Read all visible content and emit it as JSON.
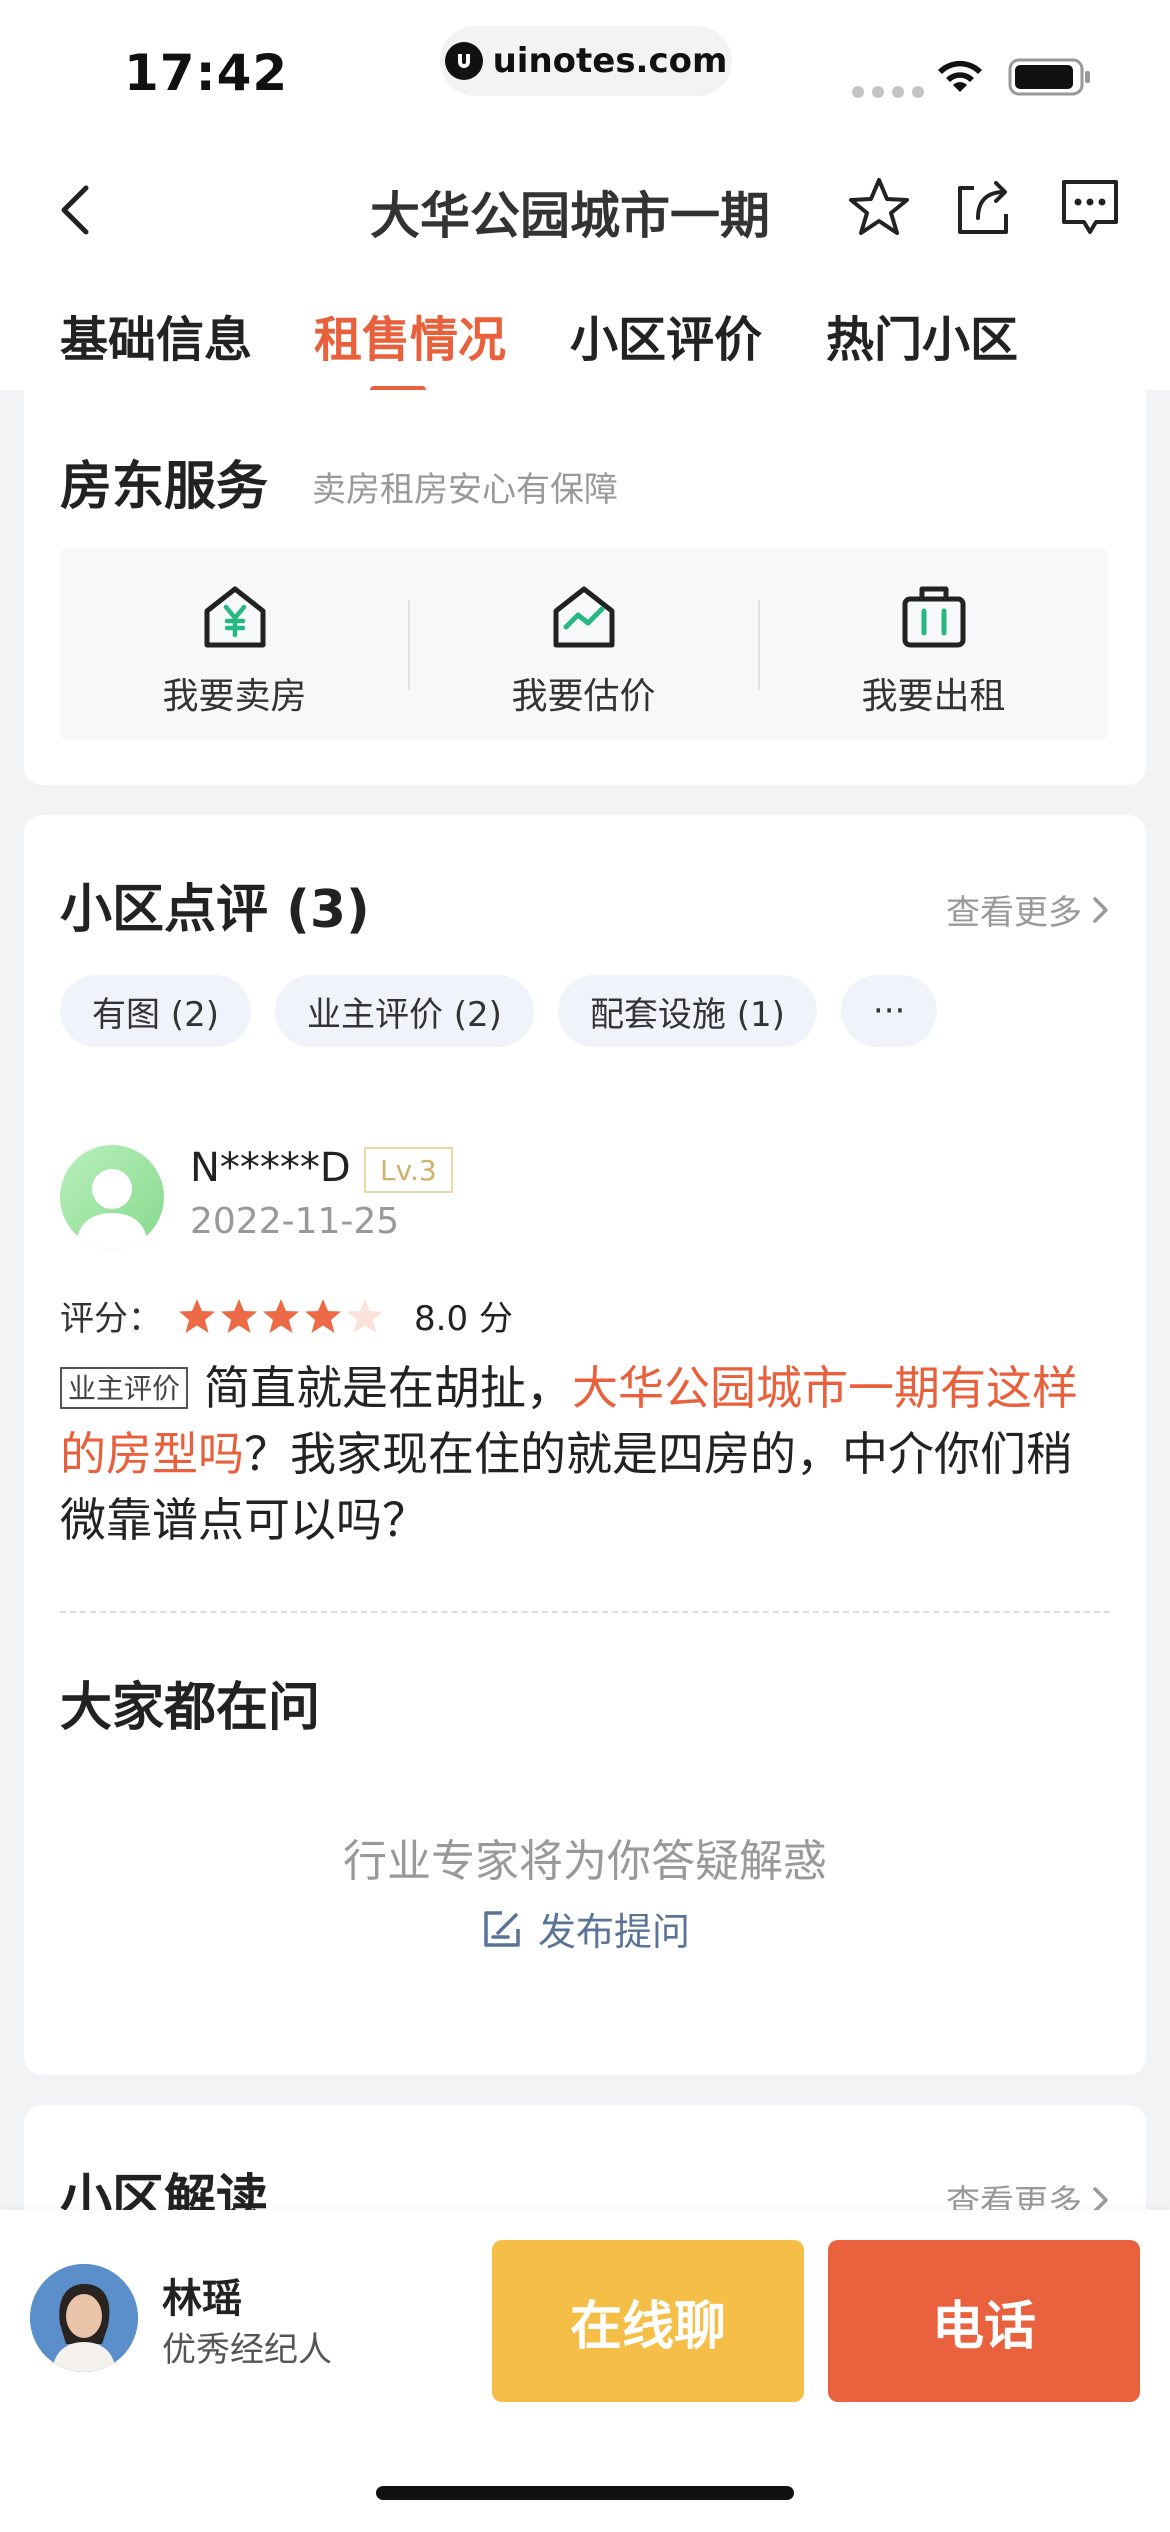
{
  "status_bar": {
    "time": "17:42",
    "url": "uinotes.com"
  },
  "nav": {
    "title": "大华公园城市一期"
  },
  "tabs": [
    {
      "label": "基础信息",
      "active": false
    },
    {
      "label": "租售情况",
      "active": true
    },
    {
      "label": "小区评价",
      "active": false
    },
    {
      "label": "热门小区",
      "active": false
    }
  ],
  "landlord": {
    "title": "房东服务",
    "subtitle": "卖房租房安心有保障",
    "services": [
      {
        "label": "我要卖房",
        "icon": "house-yen-icon"
      },
      {
        "label": "我要估价",
        "icon": "house-chart-icon"
      },
      {
        "label": "我要出租",
        "icon": "briefcase-icon"
      }
    ]
  },
  "reviews": {
    "title": "小区点评 (3)",
    "see_more": "查看更多",
    "chips": [
      "有图 (2)",
      "业主评价 (2)",
      "配套设施 (1)",
      "···"
    ],
    "item": {
      "user": "N*****D",
      "level": "Lv.3",
      "date": "2022-11-25",
      "rating_label": "评分：",
      "stars": 4,
      "max_stars": 5,
      "score": "8.0 分",
      "tag": "业主评价",
      "text_part1": "简直就是在胡扯，",
      "text_highlight": "大华公园城市一期有这样的房型吗",
      "text_part2": "？我家现在住的就是四房的，中介你们稍微靠谱点可以吗？"
    }
  },
  "qa": {
    "title": "大家都在问",
    "empty_text": "行业专家将为你答疑解惑",
    "ask_label": "发布提问"
  },
  "analysis": {
    "title": "小区解读",
    "see_more": "查看更多"
  },
  "agent": {
    "name": "林瑶",
    "title": "优秀经纪人",
    "chat_label": "在线聊",
    "call_label": "电话"
  },
  "colors": {
    "accent": "#e8603c",
    "chat_button": "#f5bf47",
    "call_button": "#e9613d"
  }
}
